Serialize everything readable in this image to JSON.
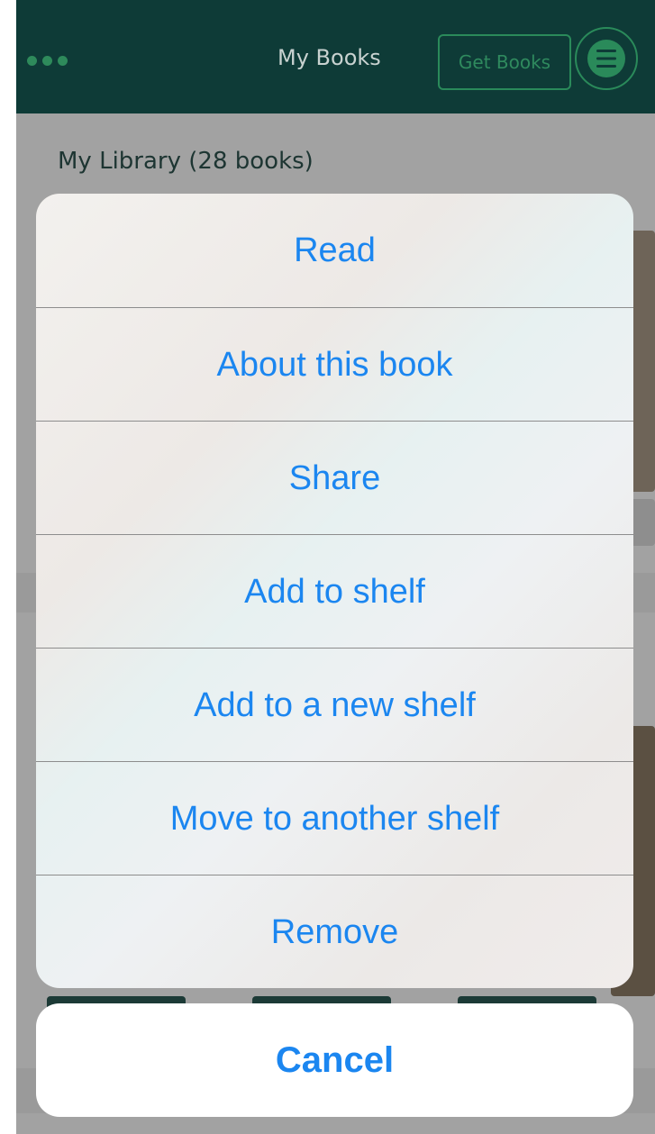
{
  "header": {
    "title": "My Books",
    "get_books_label": "Get Books"
  },
  "library": {
    "title": "My Library (28 books)"
  },
  "action_sheet": {
    "items": [
      {
        "label": "Read"
      },
      {
        "label": "About this book"
      },
      {
        "label": "Share"
      },
      {
        "label": "Add to shelf"
      },
      {
        "label": "Add to a new shelf"
      },
      {
        "label": "Move to another shelf"
      },
      {
        "label": "Remove"
      }
    ],
    "cancel_label": "Cancel"
  },
  "colors": {
    "header_bg": "#0e3b37",
    "accent_green": "#2a8a5a",
    "action_blue": "#1b86f0",
    "dim_overlay": "#a2a2a2"
  },
  "icons": {
    "menu": "hamburger-menu-icon",
    "more": "more-dots-icon"
  }
}
